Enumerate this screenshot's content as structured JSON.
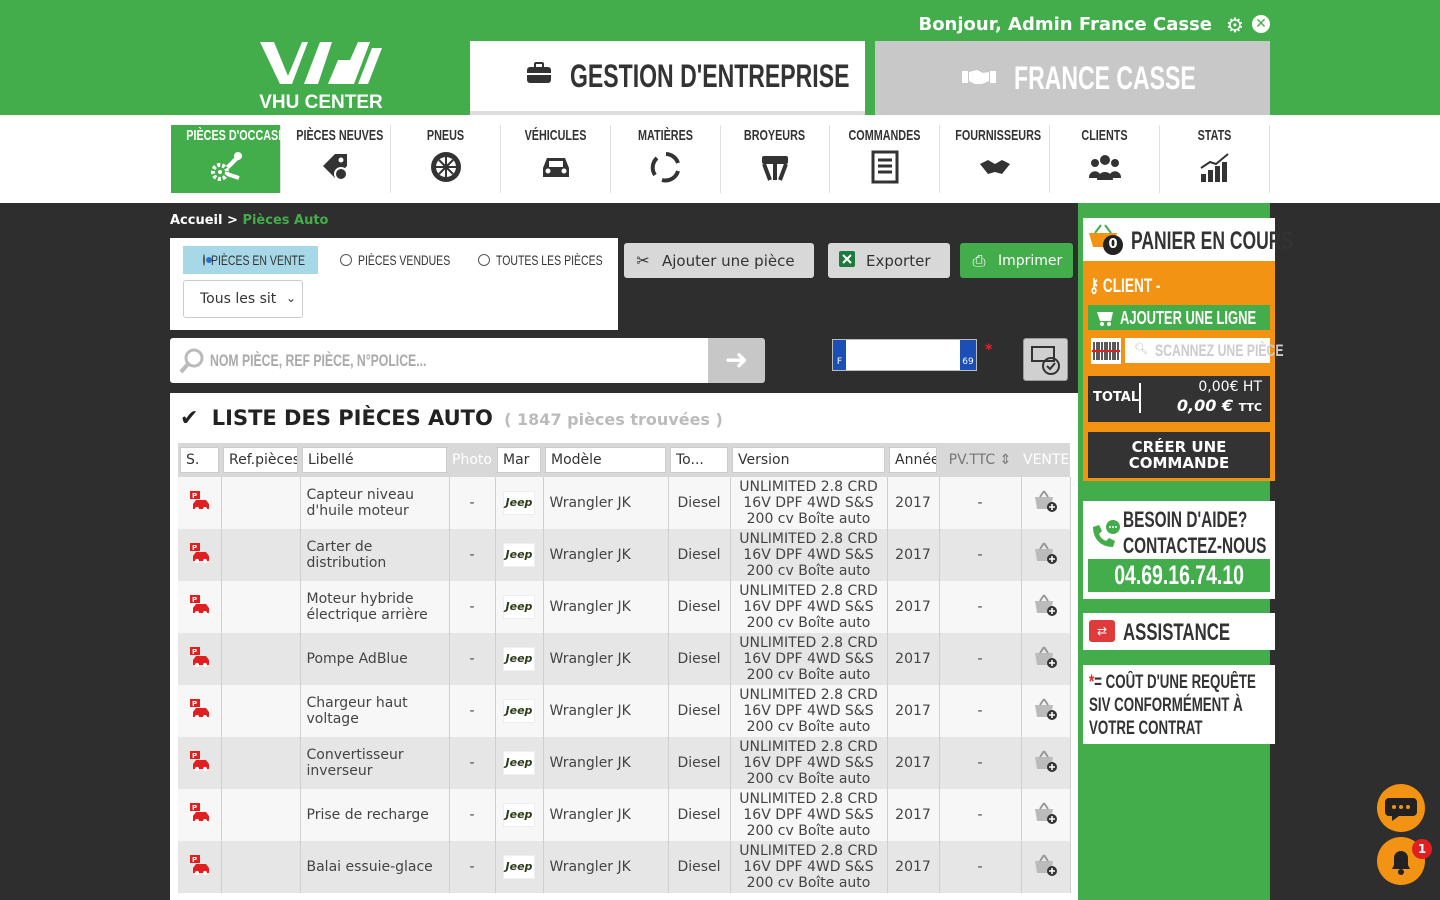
{
  "header": {
    "greeting": "Bonjour, Admin France Casse",
    "logo_text": "VHU CENTER",
    "tab_gestion": "GESTION D'ENTREPRISE",
    "tab_casse": "FRANCE CASSE"
  },
  "nav": {
    "items": [
      {
        "label": "PIÈCES D'OCCASION",
        "icon": "wrench-gear-icon",
        "active": true
      },
      {
        "label": "PIÈCES NEUVES",
        "icon": "price-tag-icon"
      },
      {
        "label": "PNEUS",
        "icon": "tire-icon"
      },
      {
        "label": "VÉHICULES",
        "icon": "car-icon"
      },
      {
        "label": "MATIÈRES",
        "icon": "recycle-icon"
      },
      {
        "label": "BROYEURS",
        "icon": "crusher-icon"
      },
      {
        "label": "COMMANDES",
        "icon": "order-list-icon"
      },
      {
        "label": "FOURNISSEURS",
        "icon": "handshake-icon"
      },
      {
        "label": "CLIENTS",
        "icon": "users-icon"
      },
      {
        "label": "STATS",
        "icon": "chart-icon"
      }
    ]
  },
  "breadcrumb": {
    "home": "Accueil",
    "sep": ">",
    "current": "Pièces Auto"
  },
  "filters": {
    "radio_vente": "PIÈCES EN VENTE",
    "radio_vendues": "PIÈCES VENDUES",
    "radio_toutes": "TOUTES LES PIÈCES",
    "site_select": "Tous les sit"
  },
  "actions": {
    "add": "Ajouter une pièce",
    "export": "Exporter",
    "print": "Imprimer"
  },
  "search": {
    "placeholder": "NOM PIÈCE, REF PIÈCE, N°POLICE...",
    "plate_left": "F",
    "plate_right": "69",
    "star": "*"
  },
  "list": {
    "title": "LISTE DES PIÈCES AUTO",
    "count": "( 1847 pièces trouvées )",
    "columns": {
      "s": "S.",
      "ref": "Ref.pièces",
      "libelle": "Libellé",
      "photo": "Photo",
      "marque": "Mar",
      "modele": "Modèle",
      "type": "To...",
      "version": "Version",
      "annee": "Année",
      "pvttc": "PV.TTC",
      "vente": "VENTE"
    },
    "rows": [
      {
        "libelle": "Capteur niveau d'huile moteur",
        "photo": "-",
        "marque": "Jeep",
        "modele": "Wrangler JK",
        "type": "Diesel",
        "version": "UNLIMITED 2.8 CRD 16V DPF 4WD S&S 200 cv Boîte auto",
        "annee": "2017",
        "pvttc": "-"
      },
      {
        "libelle": "Carter de distribution",
        "photo": "-",
        "marque": "Jeep",
        "modele": "Wrangler JK",
        "type": "Diesel",
        "version": "UNLIMITED 2.8 CRD 16V DPF 4WD S&S 200 cv Boîte auto",
        "annee": "2017",
        "pvttc": "-"
      },
      {
        "libelle": "Moteur hybride électrique arrière",
        "photo": "-",
        "marque": "Jeep",
        "modele": "Wrangler JK",
        "type": "Diesel",
        "version": "UNLIMITED 2.8 CRD 16V DPF 4WD S&S 200 cv Boîte auto",
        "annee": "2017",
        "pvttc": "-"
      },
      {
        "libelle": "Pompe AdBlue",
        "photo": "-",
        "marque": "Jeep",
        "modele": "Wrangler JK",
        "type": "Diesel",
        "version": "UNLIMITED 2.8 CRD 16V DPF 4WD S&S 200 cv Boîte auto",
        "annee": "2017",
        "pvttc": "-"
      },
      {
        "libelle": "Chargeur haut voltage",
        "photo": "-",
        "marque": "Jeep",
        "modele": "Wrangler JK",
        "type": "Diesel",
        "version": "UNLIMITED 2.8 CRD 16V DPF 4WD S&S 200 cv Boîte auto",
        "annee": "2017",
        "pvttc": "-"
      },
      {
        "libelle": "Convertisseur inverseur",
        "photo": "-",
        "marque": "Jeep",
        "modele": "Wrangler JK",
        "type": "Diesel",
        "version": "UNLIMITED 2.8 CRD 16V DPF 4WD S&S 200 cv Boîte auto",
        "annee": "2017",
        "pvttc": "-"
      },
      {
        "libelle": "Prise de recharge",
        "photo": "-",
        "marque": "Jeep",
        "modele": "Wrangler JK",
        "type": "Diesel",
        "version": "UNLIMITED 2.8 CRD 16V DPF 4WD S&S 200 cv Boîte auto",
        "annee": "2017",
        "pvttc": "-"
      },
      {
        "libelle": "Balai essuie-glace",
        "photo": "-",
        "marque": "Jeep",
        "modele": "Wrangler JK",
        "type": "Diesel",
        "version": "UNLIMITED 2.8 CRD 16V DPF 4WD S&S 200 cv Boîte auto",
        "annee": "2017",
        "pvttc": "-"
      }
    ]
  },
  "cart": {
    "title": "PANIER EN COURS",
    "badge": "0",
    "client": "CLIENT -",
    "add_line": "AJOUTER UNE LIGNE",
    "scan_placeholder": "SCANNEZ UNE PIÈCE",
    "total_label": "TOTAL",
    "total_ht": "0,00€ HT",
    "total_ttc": "0,00 €",
    "ttc_unit": "TTC",
    "create_order": "CRÉER UNE COMMANDE"
  },
  "help": {
    "line1": "BESOIN D'AIDE?",
    "line2": "CONTACTEZ-NOUS",
    "phone": "04.69.16.74.10"
  },
  "assistance": {
    "label": "ASSISTANCE"
  },
  "note": {
    "star": "*",
    "text": "= COÛT D'UNE REQUÊTE SIV CONFORMÉMENT À VOTRE CONTRAT"
  },
  "notifications": {
    "count": "1"
  },
  "colors": {
    "brand_green": "#43ad4c",
    "orange": "#f39314",
    "dark": "#2e2e2e"
  }
}
